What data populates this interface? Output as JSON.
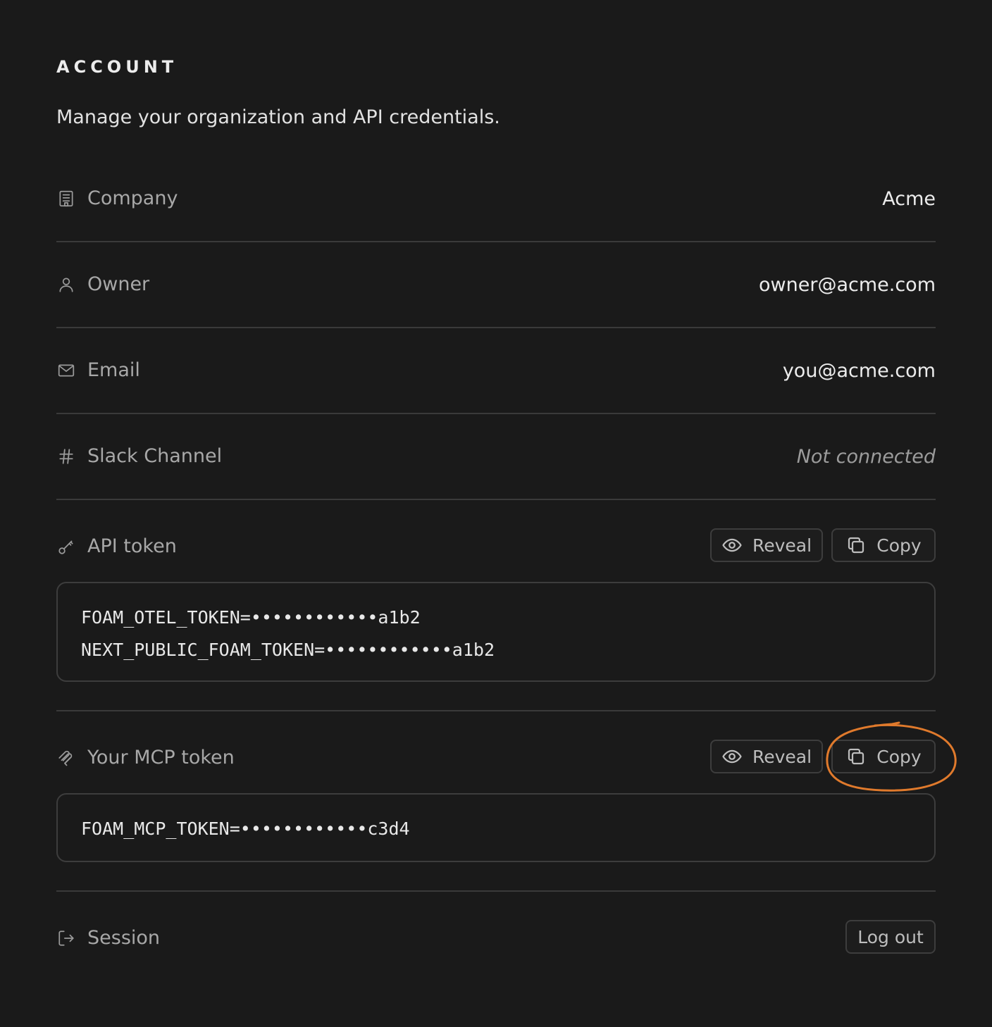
{
  "header": {
    "title": "ACCOUNT",
    "subtitle": "Manage your organization and API credentials."
  },
  "rows": {
    "company": {
      "label": "Company",
      "value": "Acme",
      "icon": "building-icon"
    },
    "owner": {
      "label": "Owner",
      "value": "owner@acme.com",
      "icon": "user-icon"
    },
    "email": {
      "label": "Email",
      "value": "you@acme.com",
      "icon": "mail-icon"
    },
    "slack": {
      "label": "Slack Channel",
      "value": "Not connected",
      "icon": "hash-icon"
    }
  },
  "api_token": {
    "label": "API token",
    "icon": "key-icon",
    "reveal_label": "Reveal",
    "copy_label": "Copy",
    "lines": [
      "FOAM_OTEL_TOKEN=••••••••••••a1b2",
      "NEXT_PUBLIC_FOAM_TOKEN=••••••••••••a1b2"
    ]
  },
  "mcp_token": {
    "label": "Your MCP token",
    "icon": "mcp-icon",
    "reveal_label": "Reveal",
    "copy_label": "Copy",
    "lines": [
      "FOAM_MCP_TOKEN=••••••••••••c3d4"
    ]
  },
  "session": {
    "label": "Session",
    "icon": "logout-icon",
    "logout_label": "Log out"
  },
  "colors": {
    "background": "#1a1a1a",
    "border": "#3a3a3a",
    "annotation": "#e07a2c"
  }
}
